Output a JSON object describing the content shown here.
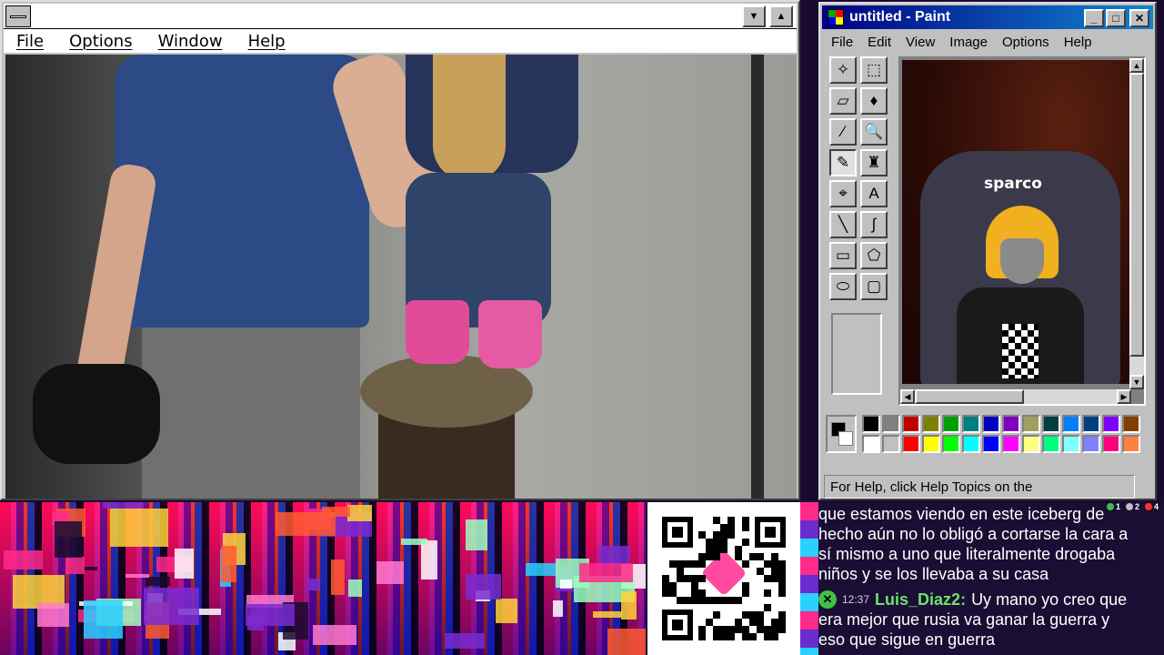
{
  "left_window": {
    "menu": [
      "File",
      "Options",
      "Window",
      "Help"
    ],
    "title_buttons": {
      "minimize": "▼",
      "maximize": "▲"
    }
  },
  "paint": {
    "title": "untitled - Paint",
    "title_buttons": {
      "minimize": "_",
      "maximize": "□",
      "close": "✕"
    },
    "menu": [
      "File",
      "Edit",
      "View",
      "Image",
      "Options",
      "Help"
    ],
    "tools": [
      {
        "name": "free-form-select-icon",
        "glyph": "✧"
      },
      {
        "name": "select-icon",
        "glyph": "⬚"
      },
      {
        "name": "eraser-icon",
        "glyph": "▱"
      },
      {
        "name": "fill-with-color-icon",
        "glyph": "♦"
      },
      {
        "name": "pick-color-icon",
        "glyph": "∕"
      },
      {
        "name": "magnifier-icon",
        "glyph": "🔍"
      },
      {
        "name": "pencil-icon",
        "glyph": "✎"
      },
      {
        "name": "brush-icon",
        "glyph": "♜"
      },
      {
        "name": "airbrush-icon",
        "glyph": "⌖"
      },
      {
        "name": "text-icon",
        "glyph": "A"
      },
      {
        "name": "line-icon",
        "glyph": "╲"
      },
      {
        "name": "curve-icon",
        "glyph": "∫"
      },
      {
        "name": "rectangle-icon",
        "glyph": "▭"
      },
      {
        "name": "polygon-icon",
        "glyph": "⬠"
      },
      {
        "name": "ellipse-icon",
        "glyph": "⬭"
      },
      {
        "name": "rounded-rectangle-icon",
        "glyph": "▢"
      }
    ],
    "active_tool": "pencil-icon",
    "canvas_text": "sparco",
    "palette_top": [
      "#000000",
      "#808080",
      "#c00000",
      "#808000",
      "#00a000",
      "#008080",
      "#0000c0",
      "#8000c0",
      "#a0a060",
      "#004040",
      "#0080ff",
      "#004080",
      "#8000ff",
      "#804000"
    ],
    "palette_bottom": [
      "#ffffff",
      "#c0c0c0",
      "#ff0000",
      "#ffff00",
      "#00ff00",
      "#00ffff",
      "#0000ff",
      "#ff00ff",
      "#ffff80",
      "#00ff80",
      "#80ffff",
      "#8080ff",
      "#ff0080",
      "#ff8040"
    ],
    "status": "For Help, click Help Topics on the"
  },
  "chat": {
    "counts": [
      "1",
      "2",
      "4"
    ],
    "message1": [
      "que estamos viendo en este iceberg de",
      "hecho aún no lo obligó a cortarse la cara a",
      "sí mismo a uno que literalmente drogaba",
      "niños y se los llevaba a su casa"
    ],
    "message2": {
      "time": "12:37",
      "user": "Luis_Diaz2:",
      "text_first": "Uy mano yo creo que",
      "text_rest": [
        "era mejor que rusia va ganar la guerra y",
        "eso que sigue en guerra"
      ]
    }
  }
}
